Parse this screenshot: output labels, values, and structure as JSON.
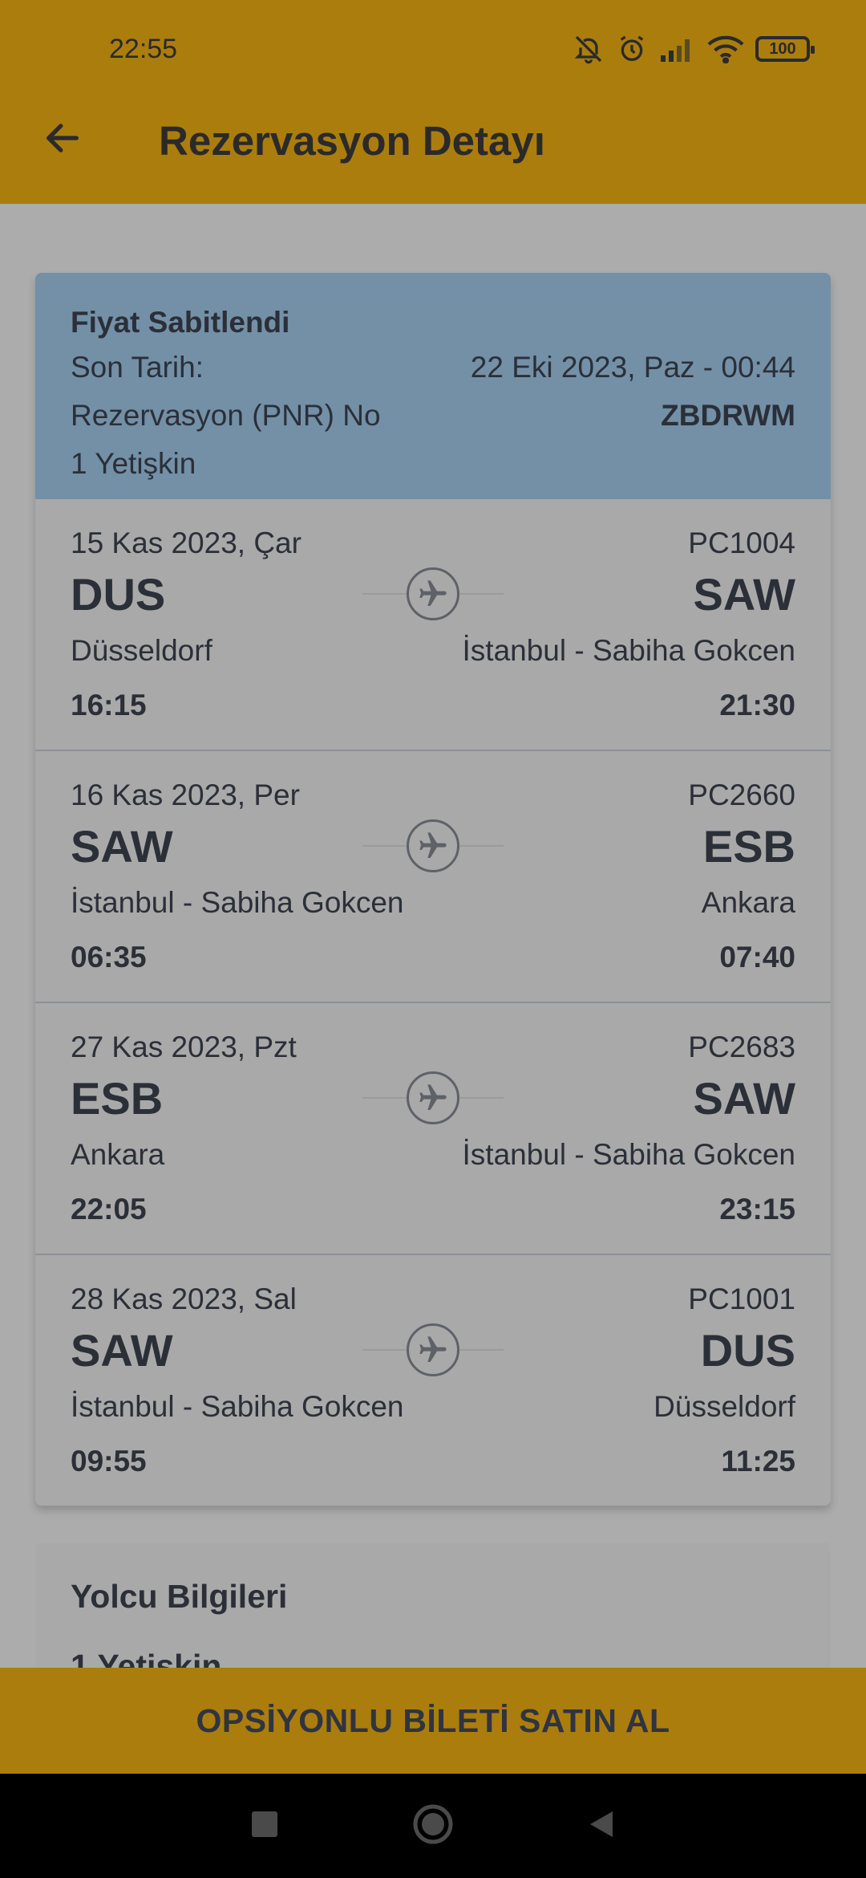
{
  "status_bar": {
    "time": "22:55",
    "battery": "100",
    "icons": [
      "bell-off-icon",
      "alarm-icon",
      "signal-icon",
      "wifi-icon",
      "battery-icon"
    ]
  },
  "app_bar": {
    "title": "Rezervasyon Detayı",
    "back_icon": "arrow-left-icon"
  },
  "reservation": {
    "status": "Fiyat Sabitlendi",
    "deadline_label": "Son Tarih:",
    "deadline_value": "22 Eki 2023, Paz - 00:44",
    "pnr_label": "Rezervasyon (PNR) No",
    "pnr_value": "ZBDRWM",
    "passengers": "1 Yetişkin"
  },
  "flights": [
    {
      "date": "15 Kas 2023, Çar",
      "flight_no": "PC1004",
      "from_code": "DUS",
      "to_code": "SAW",
      "from_city": "Düsseldorf",
      "to_city": "İstanbul - Sabiha Gokcen",
      "departure": "16:15",
      "arrival": "21:30"
    },
    {
      "date": "16 Kas 2023, Per",
      "flight_no": "PC2660",
      "from_code": "SAW",
      "to_code": "ESB",
      "from_city": "İstanbul - Sabiha Gokcen",
      "to_city": "Ankara",
      "departure": "06:35",
      "arrival": "07:40"
    },
    {
      "date": "27 Kas 2023, Pzt",
      "flight_no": "PC2683",
      "from_code": "ESB",
      "to_code": "SAW",
      "from_city": "Ankara",
      "to_city": "İstanbul - Sabiha Gokcen",
      "departure": "22:05",
      "arrival": "23:15"
    },
    {
      "date": "28 Kas 2023, Sal",
      "flight_no": "PC1001",
      "from_code": "SAW",
      "to_code": "DUS",
      "from_city": "İstanbul - Sabiha Gokcen",
      "to_city": "Düsseldorf",
      "departure": "09:55",
      "arrival": "11:25"
    }
  ],
  "passenger_section": {
    "title": "Yolcu Bilgileri",
    "subtitle": "1 Yetişkin"
  },
  "cta": {
    "label": "OPSİYONLU BİLETİ SATIN AL"
  },
  "colors": {
    "app_bar": "#ab7d0d",
    "info_block": "#7390a7",
    "background": "#acacac",
    "card": "#a9a9a9"
  }
}
